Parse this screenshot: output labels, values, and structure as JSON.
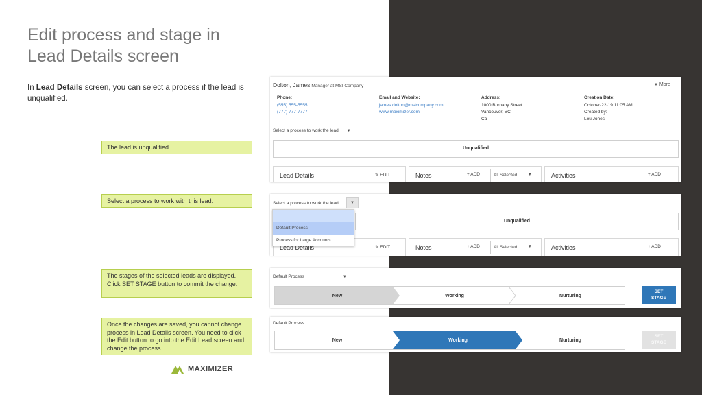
{
  "slide": {
    "title_line1": "Edit process and stage in",
    "title_line2": "Lead Details screen",
    "intro_bold": "Lead Details",
    "intro_pre": "In ",
    "intro_post": " screen, you can select a process if the lead is unqualified.",
    "callouts": [
      "The lead is unqualified.",
      "Select a process to work with this lead.",
      "The stages of the selected leads are displayed. Click SET STAGE button to commit the change.",
      "Once the changes are saved, you cannot change process in Lead Details screen. You need to click the Edit button to go into the Edit Lead screen and change the process."
    ],
    "logo_text": "MAXIMIZER"
  },
  "colors": {
    "dark_panel": "#373432",
    "callout_bg": "#e6f2a2",
    "accent_blue": "#2f77b8",
    "link_blue": "#3a7cc4",
    "logo_green": "#9bb83a"
  },
  "lead": {
    "name": "Dolton, James",
    "job": "Manager at MSI Company",
    "more": "More",
    "phone_label": "Phone:",
    "phone1": "(555) 555-5555",
    "phone2": "(777) 777-7777",
    "email_label": "Email and Website:",
    "email": "james.dolton@msicompany.com",
    "website": "www.maximizer.com",
    "address_label": "Address:",
    "address1": "1000 Burnaby Street",
    "address2": "Vancouver, BC",
    "address3": "Ca",
    "created_label": "Creation Date:",
    "created_date": "October-22-19 11:05 AM",
    "created_by_label": "Created by:",
    "created_by": "Lou Jones"
  },
  "process": {
    "placeholder": "Select a process to work the lead",
    "status": "Unqualified",
    "options": [
      "Default Process",
      "Process for Large Accounts"
    ],
    "selected": "Default Process"
  },
  "cards": {
    "lead_details": "Lead Details",
    "edit": "EDIT",
    "notes": "Notes",
    "add": "ADD",
    "filter": "All Selected",
    "activities": "Activities"
  },
  "stages": {
    "items": [
      "New",
      "Working",
      "Nurturing"
    ],
    "set_stage_line1": "SET",
    "set_stage_line2": "STAGE",
    "before_active": "New",
    "after_active": "Working"
  }
}
